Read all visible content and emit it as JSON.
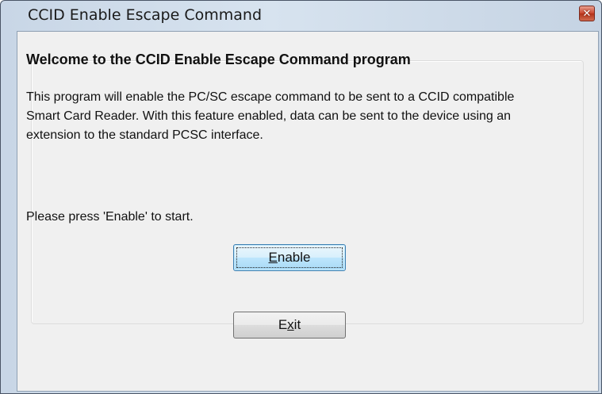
{
  "window": {
    "title": "CCID Enable Escape Command",
    "close_glyph": "✕"
  },
  "content": {
    "heading": "Welcome to the CCID Enable Escape Command program",
    "description": "This program will enable the PC/SC escape command to be sent to a CCID compatible Smart Card Reader. With this feature enabled, data can be sent to the device using an extension to the standard PCSC interface.",
    "prompt": "Please press 'Enable' to start."
  },
  "buttons": {
    "enable": {
      "mnemonic": "E",
      "rest": "nable"
    },
    "exit": {
      "before": "E",
      "mnemonic": "x",
      "rest": "it"
    }
  },
  "icons": [
    "close-icon"
  ]
}
